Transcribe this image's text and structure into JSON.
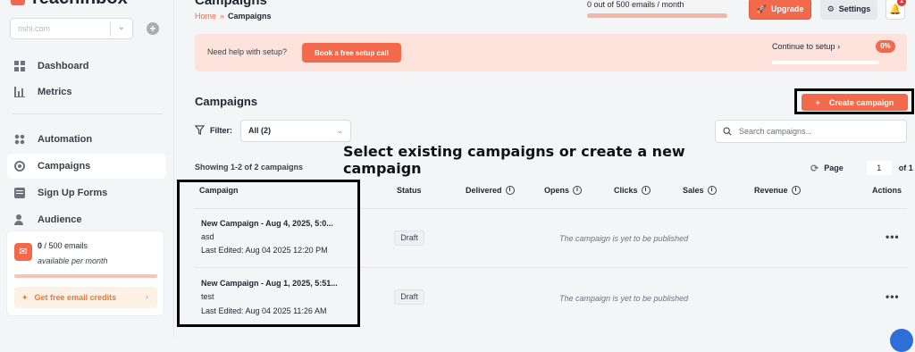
{
  "sidebar": {
    "brand": "reachinbox",
    "workspace": "rishi.com",
    "nav": [
      {
        "label": "Dashboard"
      },
      {
        "label": "Metrics"
      },
      {
        "label": "Automation"
      },
      {
        "label": "Campaigns",
        "active": true
      },
      {
        "label": "Sign Up Forms"
      },
      {
        "label": "Audience"
      }
    ],
    "email_card": {
      "used": "0",
      "total": "/ 500 emails",
      "sub": "available per month",
      "cta": "Get free email credits"
    }
  },
  "header": {
    "title": "Campaigns",
    "crumb_home": "Home",
    "crumb_sep": "»",
    "crumb_current": "Campaigns",
    "quota": "0 out of 500 emails / month",
    "quota_fraction": 0,
    "upgrade": "Upgrade",
    "settings": "Settings",
    "notif_count": "1"
  },
  "banner": {
    "question": "Need help with setup?",
    "cta": "Book a free setup call",
    "continue": "Continue to setup",
    "percent": "0%"
  },
  "campaigns": {
    "title": "Campaigns",
    "create": "Create campaign",
    "filter_label": "Filter:",
    "filter_value": "All (2)",
    "search_placeholder": "Search campaigns...",
    "showing": "Showing 1-2 of 2 campaigns",
    "page_label": "Page",
    "page_value": "1",
    "page_total": "of 1",
    "columns": [
      "Campaign",
      "Status",
      "Delivered",
      "Opens",
      "Clicks",
      "Sales",
      "Revenue",
      "Actions"
    ],
    "rows": [
      {
        "name": "New Campaign - Aug 4, 2025, 5:0...",
        "sub": "asd",
        "edited": "Last Edited: Aug 04 2025 12:20 PM",
        "status": "Draft",
        "note": "The campaign is yet to be published"
      },
      {
        "name": "New Campaign - Aug 1, 2025, 5:51...",
        "sub": "test",
        "edited": "Last Edited: Aug 04 2025 11:26 AM",
        "status": "Draft",
        "note": "The campaign is yet to be published"
      }
    ]
  },
  "annotation": "Select existing campaigns or create a new campaign",
  "colors": {
    "accent": "#f26a4b",
    "banner": "#fde3dc"
  }
}
